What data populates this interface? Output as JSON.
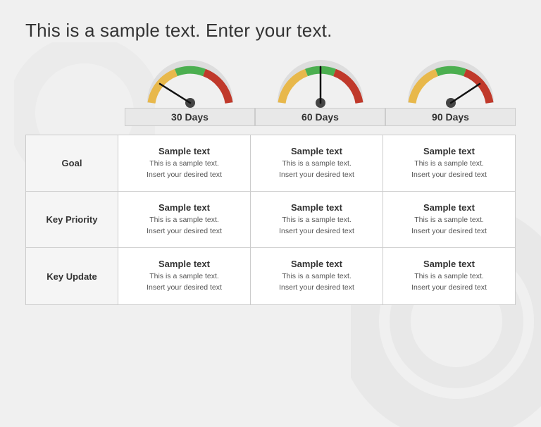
{
  "title": "This is a sample text. Enter your text.",
  "gauges": [
    {
      "label": "30 Days",
      "needle_angle": -30,
      "colors": [
        "#e8b84b",
        "#4caf50",
        "#c0392b"
      ]
    },
    {
      "label": "60 Days",
      "needle_angle": -10,
      "colors": [
        "#e8b84b",
        "#4caf50",
        "#c0392b"
      ]
    },
    {
      "label": "90 Days",
      "needle_angle": 40,
      "colors": [
        "#e8b84b",
        "#4caf50",
        "#c0392b"
      ]
    }
  ],
  "rows": [
    {
      "label": "Goal"
    },
    {
      "label": "Key Priority"
    },
    {
      "label": "Key Update"
    }
  ],
  "cell_title": "Sample text",
  "cell_line1": "This is a sample text.",
  "cell_line2": "Insert your desired text"
}
